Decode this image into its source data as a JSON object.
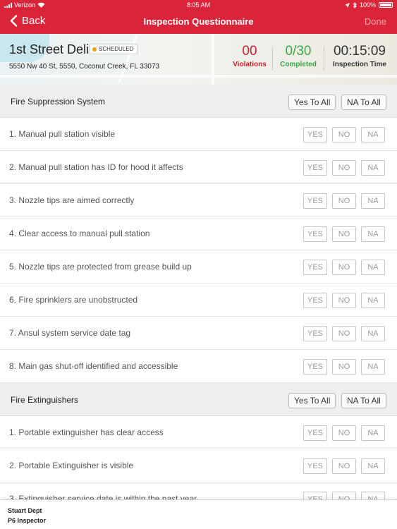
{
  "status_bar": {
    "carrier": "Verizon",
    "time": "8:05 AM",
    "battery": "100%"
  },
  "nav": {
    "back_label": "Back",
    "title": "Inspection Questionnaire",
    "done_label": "Done"
  },
  "header": {
    "business_name": "1st Street Deli",
    "status_badge": "SCHEDULED",
    "address": "5550 Nw 40 St, 5550, Coconut Creek, FL 33073",
    "violations": {
      "value": "00",
      "label": "Violations"
    },
    "completed": {
      "value": "0/30",
      "label": "Completed"
    },
    "time": {
      "value": "00:15:09",
      "label": "Inspection Time"
    }
  },
  "answer_labels": {
    "yes": "YES",
    "no": "NO",
    "na": "NA"
  },
  "sections": [
    {
      "title": "Fire Suppression System",
      "yes_all": "Yes To All",
      "na_all": "NA To All",
      "questions": [
        "1. Manual pull station visible",
        "2. Manual pull station has ID for hood it affects",
        "3. Nozzle tips are aimed correctly",
        "4. Clear access to manual pull station",
        "5. Nozzle tips are protected from grease build up",
        "6. Fire sprinklers are unobstructed",
        "7. Ansul system service date tag",
        "8. Main gas shut-off identified and accessible"
      ]
    },
    {
      "title": "Fire Extinguishers",
      "yes_all": "Yes To All",
      "na_all": "NA To All",
      "questions": [
        "1. Portable extinguisher has clear access",
        "2. Portable Extinguisher is visible",
        "3. Extinguisher service date is within the past year"
      ]
    }
  ],
  "footer": {
    "line1": "Stuart Dept",
    "line2": "P6 Inspector"
  },
  "colors": {
    "brand_red": "#d9243a",
    "violations": "#c8202f",
    "completed": "#3aa64a",
    "time": "#333333"
  }
}
